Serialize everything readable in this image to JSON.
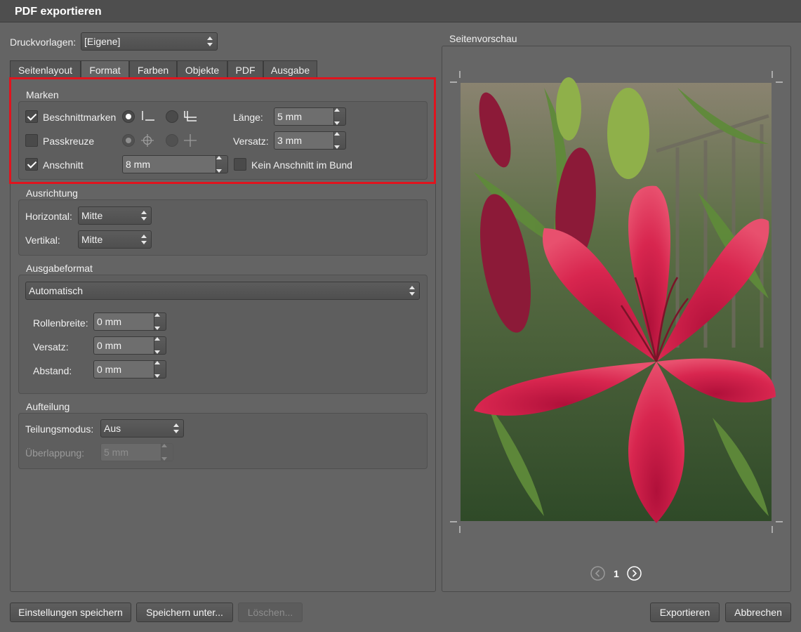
{
  "window": {
    "title": "PDF exportieren"
  },
  "presets": {
    "label": "Druckvorlagen:",
    "value": "[Eigene]"
  },
  "tabs": [
    "Seitenlayout",
    "Format",
    "Farben",
    "Objekte",
    "PDF",
    "Ausgabe"
  ],
  "active_tab": "Format",
  "marks": {
    "title": "Marken",
    "crop_marks": {
      "label": "Beschnittmarken",
      "checked": true
    },
    "registration": {
      "label": "Passkreuze",
      "checked": false
    },
    "bleed": {
      "label": "Anschnitt",
      "checked": true,
      "value": "8 mm"
    },
    "length": {
      "label": "Länge:",
      "value": "5 mm"
    },
    "offset": {
      "label": "Versatz:",
      "value": "3 mm"
    },
    "no_bleed_binding": {
      "label": "Kein Anschnitt im Bund",
      "checked": false
    }
  },
  "alignment": {
    "title": "Ausrichtung",
    "horizontal": {
      "label": "Horizontal:",
      "value": "Mitte"
    },
    "vertical": {
      "label": "Vertikal:",
      "value": "Mitte"
    }
  },
  "output_format": {
    "title": "Ausgabeformat",
    "value": "Automatisch",
    "roll_width": {
      "label": "Rollenbreite:",
      "value": "0 mm"
    },
    "offset": {
      "label": "Versatz:",
      "value": "0 mm"
    },
    "spacing": {
      "label": "Abstand:",
      "value": "0 mm"
    }
  },
  "tiling": {
    "title": "Aufteilung",
    "mode": {
      "label": "Teilungsmodus:",
      "value": "Aus"
    },
    "overlap": {
      "label": "Überlappung:",
      "value": "5 mm"
    }
  },
  "preview": {
    "title": "Seitenvorschau",
    "page": "1"
  },
  "buttons": {
    "save_settings": "Einstellungen speichern",
    "save_as": "Speichern unter...",
    "delete": "Löschen...",
    "export": "Exportieren",
    "cancel": "Abbrechen"
  },
  "colors": {
    "highlight": "#e0141e",
    "background": "#646464"
  },
  "icons": [
    "crop-marks-style-1-icon",
    "crop-marks-style-2-icon",
    "registration-target-icon",
    "registration-cross-icon",
    "chevron-left-icon",
    "chevron-right-icon"
  ]
}
